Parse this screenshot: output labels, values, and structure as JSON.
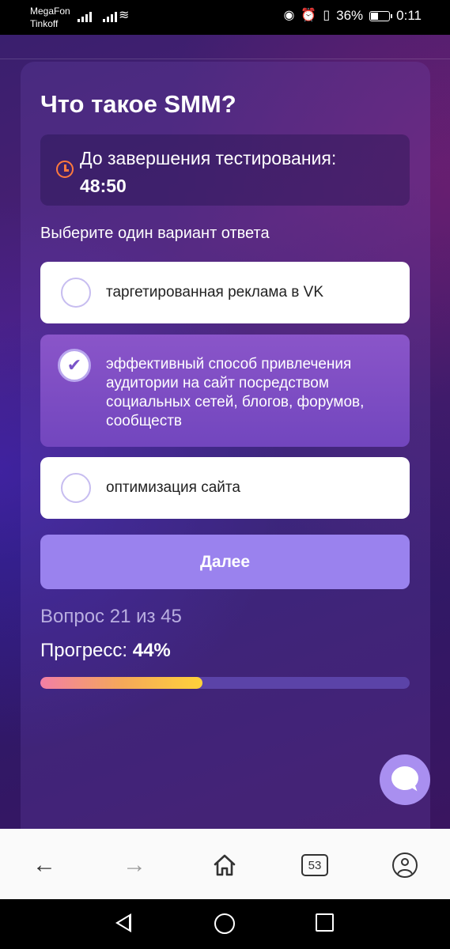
{
  "status_bar": {
    "carrier_1": "MegaFon",
    "carrier_2": "Tinkoff",
    "battery_percent": "36%",
    "time": "0:11",
    "icons": [
      "signal-icon",
      "signal-icon",
      "wifi-icon",
      "eye-icon",
      "alarm-icon",
      "vibrate-icon",
      "battery-icon"
    ]
  },
  "quiz": {
    "title": "Что такое SMM?",
    "timer_label": "До завершения тестирования:",
    "timer_value": "48:50",
    "instruction": "Выберите один вариант ответа",
    "options": [
      {
        "text": "таргетированная реклама в VK",
        "selected": false
      },
      {
        "text": "эффективный способ привлечения аудитории на сайт посредством социальных сетей, блогов, форумов, сообществ",
        "selected": true
      },
      {
        "text": "оптимизация сайта",
        "selected": false
      }
    ],
    "next_button": "Далее",
    "question_counter": "Вопрос 21 из 45",
    "progress_label": "Прогресс:",
    "progress_value": "44%",
    "progress_fraction": 0.44
  },
  "browser_nav": {
    "tabs_count": "53",
    "icons": [
      "back-arrow-icon",
      "forward-arrow-icon",
      "home-icon",
      "tabs-icon",
      "profile-icon"
    ]
  },
  "colors": {
    "accent": "#9a82ee",
    "selected_option": "#7f4fc4",
    "timer_icon": "#ff7a3d",
    "progress_start": "#f27fa5",
    "progress_end": "#ffd23a"
  }
}
